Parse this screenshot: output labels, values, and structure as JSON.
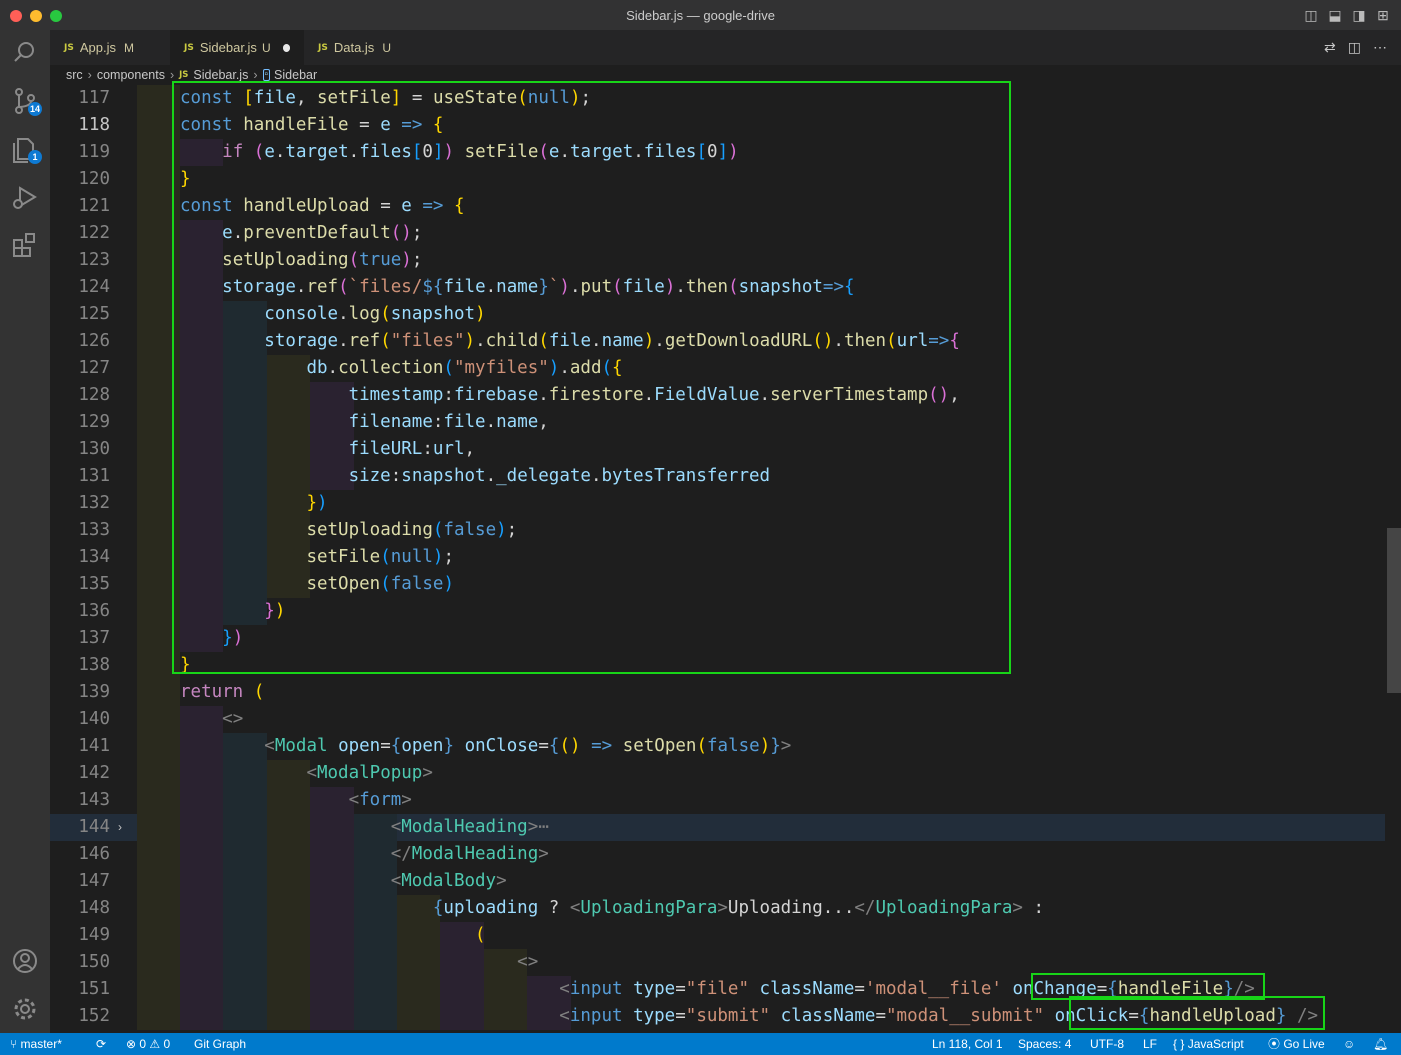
{
  "window": {
    "title": "Sidebar.js — google-drive"
  },
  "activity_bar": {
    "source_control_badge": "14",
    "explorer_badge": "1"
  },
  "tabs": [
    {
      "label": "App.js",
      "status": "M"
    },
    {
      "label": "Sidebar.js",
      "status": "U"
    },
    {
      "label": "Data.js",
      "status": "U"
    }
  ],
  "breadcrumb": {
    "folder1": "src",
    "folder2": "components",
    "file": "Sidebar.js",
    "symbol": "Sidebar"
  },
  "editor": {
    "current_line": "118",
    "lines": [
      {
        "n": "117",
        "html": "<span class='kw'>const</span> <span class='brk1'>[</span><span class='var'>file</span>, <span class='fn'>setFile</span><span class='brk1'>]</span> = <span class='fn'>useState</span><span class='brk1'>(</span><span class='cst'>null</span><span class='brk1'>)</span>;"
      },
      {
        "n": "118",
        "html": "<span class='kw'>const</span> <span class='fn'>handleFile</span> = <span class='var'>e</span> <span class='kw'>=&gt;</span> <span class='brk1'>{</span>"
      },
      {
        "n": "119",
        "html": "    <span class='ctl'>if</span> <span class='brk2'>(</span><span class='var'>e</span>.<span class='var'>target</span>.<span class='var'>files</span><span class='brk3'>[</span>0<span class='brk3'>]</span><span class='brk2'>)</span> <span class='fn'>setFile</span><span class='brk2'>(</span><span class='var'>e</span>.<span class='var'>target</span>.<span class='var'>files</span><span class='brk3'>[</span>0<span class='brk3'>]</span><span class='brk2'>)</span>"
      },
      {
        "n": "120",
        "html": "<span class='brk1'>}</span>"
      },
      {
        "n": "121",
        "html": "<span class='kw'>const</span> <span class='fn'>handleUpload</span> = <span class='var'>e</span> <span class='kw'>=&gt;</span> <span class='brk1'>{</span>"
      },
      {
        "n": "122",
        "html": "    <span class='var'>e</span>.<span class='fn'>preventDefault</span><span class='brk2'>()</span>;"
      },
      {
        "n": "123",
        "html": "    <span class='fn'>setUploading</span><span class='brk2'>(</span><span class='cst'>true</span><span class='brk2'>)</span>;"
      },
      {
        "n": "124",
        "html": "    <span class='var'>storage</span>.<span class='fn'>ref</span><span class='brk2'>(</span><span class='tpl'>`files/</span><span class='kw'>${</span><span class='var'>file</span>.<span class='var'>name</span><span class='kw'>}</span><span class='tpl'>`</span><span class='brk2'>)</span>.<span class='fn'>put</span><span class='brk2'>(</span><span class='var'>file</span><span class='brk2'>)</span>.<span class='fn'>then</span><span class='brk2'>(</span><span class='var'>snapshot</span><span class='kw'>=&gt;</span><span class='brk3'>{</span>"
      },
      {
        "n": "125",
        "html": "        <span class='var'>console</span>.<span class='fn'>log</span><span class='brk1'>(</span><span class='var'>snapshot</span><span class='brk1'>)</span>"
      },
      {
        "n": "126",
        "html": "        <span class='var'>storage</span>.<span class='fn'>ref</span><span class='brk1'>(</span><span class='str'>\"files\"</span><span class='brk1'>)</span>.<span class='fn'>child</span><span class='brk1'>(</span><span class='var'>file</span>.<span class='var'>name</span><span class='brk1'>)</span>.<span class='fn'>getDownloadURL</span><span class='brk1'>()</span>.<span class='fn'>then</span><span class='brk1'>(</span><span class='var'>url</span><span class='kw'>=&gt;</span><span class='brk2'>{</span>"
      },
      {
        "n": "127",
        "html": "            <span class='var'>db</span>.<span class='fn'>collection</span><span class='brk3'>(</span><span class='str'>\"myfiles\"</span><span class='brk3'>)</span>.<span class='fn'>add</span><span class='brk3'>(</span><span class='brk1'>{</span>"
      },
      {
        "n": "128",
        "html": "                <span class='var'>timestamp</span>:<span class='var'>firebase</span>.<span class='fn'>firestore</span>.<span class='var'>FieldValue</span>.<span class='fn'>serverTimestamp</span><span class='brk2'>()</span>,"
      },
      {
        "n": "129",
        "html": "                <span class='var'>filename</span>:<span class='var'>file</span>.<span class='var'>name</span>,"
      },
      {
        "n": "130",
        "html": "                <span class='var'>fileURL</span>:<span class='var'>url</span>,"
      },
      {
        "n": "131",
        "html": "                <span class='var'>size</span>:<span class='var'>snapshot</span>.<span class='var'>_delegate</span>.<span class='var'>bytesTransferred</span>"
      },
      {
        "n": "132",
        "html": "            <span class='brk1'>}</span><span class='brk3'>)</span>"
      },
      {
        "n": "133",
        "html": "            <span class='fn'>setUploading</span><span class='brk3'>(</span><span class='cst'>false</span><span class='brk3'>)</span>;"
      },
      {
        "n": "134",
        "html": "            <span class='fn'>setFile</span><span class='brk3'>(</span><span class='cst'>null</span><span class='brk3'>)</span>;"
      },
      {
        "n": "135",
        "html": "            <span class='fn'>setOpen</span><span class='brk3'>(</span><span class='cst'>false</span><span class='brk3'>)</span>"
      },
      {
        "n": "136",
        "html": "        <span class='brk2'>}</span><span class='brk1'>)</span>"
      },
      {
        "n": "137",
        "html": "    <span class='brk3'>}</span><span class='brk2'>)</span>"
      },
      {
        "n": "138",
        "html": "<span class='brk1'>}</span>"
      },
      {
        "n": "139",
        "html": "<span class='ctl'>return</span> <span class='brk1'>(</span>"
      },
      {
        "n": "140",
        "html": "    <span class='ang'>&lt;&gt;</span>"
      },
      {
        "n": "141",
        "html": "        <span class='ang'>&lt;</span><span class='tag'>Modal</span> <span class='attr'>open</span>=<span class='kw'>{</span><span class='var'>open</span><span class='kw'>}</span> <span class='attr'>onClose</span>=<span class='kw'>{</span><span class='brk1'>()</span> <span class='kw'>=&gt;</span> <span class='fn'>setOpen</span><span class='brk1'>(</span><span class='cst'>false</span><span class='brk1'>)</span><span class='kw'>}</span><span class='ang'>&gt;</span>"
      },
      {
        "n": "142",
        "html": "            <span class='ang'>&lt;</span><span class='tag'>ModalPopup</span><span class='ang'>&gt;</span>"
      },
      {
        "n": "143",
        "html": "                <span class='ang'>&lt;</span><span class='kw'>form</span><span class='ang'>&gt;</span>"
      },
      {
        "n": "144",
        "html": "                    <span class='ang'>&lt;</span><span class='tag'>ModalHeading</span><span class='ang'>&gt;</span><span class='ang'>⋯</span>"
      },
      {
        "n": "146",
        "html": "                    <span class='ang'>&lt;/</span><span class='tag'>ModalHeading</span><span class='ang'>&gt;</span>"
      },
      {
        "n": "147",
        "html": "                    <span class='ang'>&lt;</span><span class='tag'>ModalBody</span><span class='ang'>&gt;</span>"
      },
      {
        "n": "148",
        "html": "                        <span class='kw'>{</span><span class='var'>uploading</span> ? <span class='ang'>&lt;</span><span class='tag'>UploadingPara</span><span class='ang'>&gt;</span>Uploading...<span class='ang'>&lt;/</span><span class='tag'>UploadingPara</span><span class='ang'>&gt;</span> :"
      },
      {
        "n": "149",
        "html": "                            <span class='brk1'>(</span>"
      },
      {
        "n": "150",
        "html": "                                <span class='ang'>&lt;&gt;</span>"
      },
      {
        "n": "151",
        "html": "                                    <span class='ang'>&lt;</span><span class='kw'>input</span> <span class='attr'>type</span>=<span class='str'>\"file\"</span> <span class='attr'>className</span>=<span class='str'>'modal__file'</span> <span class='attr'>onChange</span>=<span class='kw'>{</span><span class='fn'>handleFile</span><span class='kw'>}</span><span class='ang'>/&gt;</span>"
      },
      {
        "n": "152",
        "html": "                                    <span class='ang'>&lt;</span><span class='kw'>input</span> <span class='attr'>type</span>=<span class='str'>\"submit\"</span> <span class='attr'>className</span>=<span class='str'>\"modal__submit\"</span> <span class='attr'>onClick</span>=<span class='kw'>{</span><span class='fn'>handleUpload</span><span class='kw'>}</span> <span class='ang'>/&gt;</span>"
      }
    ]
  },
  "status_bar": {
    "branch": "master*",
    "errors": "0",
    "warnings": "0",
    "git_graph": "Git Graph",
    "position": "Ln 118, Col 1",
    "spaces": "Spaces: 4",
    "encoding": "UTF-8",
    "eol": "LF",
    "language": "JavaScript",
    "go_live": "Go Live"
  },
  "colors": {
    "highlight_box": "#18d418",
    "status_bar": "#007acc"
  }
}
